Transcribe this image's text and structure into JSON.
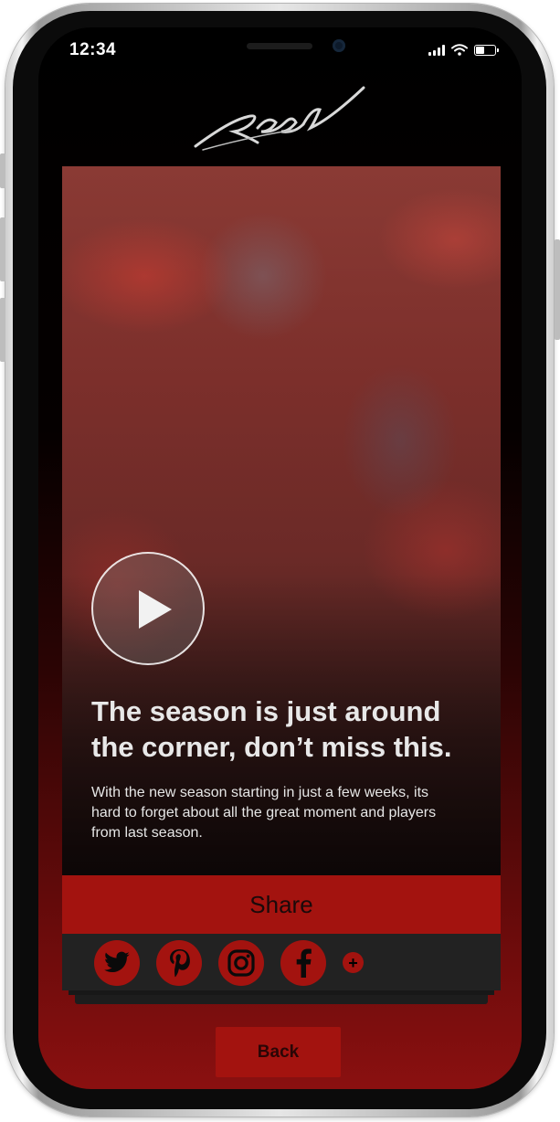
{
  "status_bar": {
    "time": "12:34",
    "battery_level": 0.45
  },
  "app": {
    "logo_icon": "reel-script-logo"
  },
  "story": {
    "headline": "The season is just around the corner, don’t miss this.",
    "body": "With the new season starting in just a few weeks, its hard to forget about all the great moment and players from last season."
  },
  "share": {
    "label": "Share",
    "networks": [
      {
        "name": "Twitter",
        "icon": "twitter-icon"
      },
      {
        "name": "Pinterest",
        "icon": "pinterest-icon"
      },
      {
        "name": "Instagram",
        "icon": "instagram-icon"
      },
      {
        "name": "Facebook",
        "icon": "facebook-icon"
      }
    ],
    "more_symbol": "+"
  },
  "back": {
    "label": "Back"
  },
  "colors": {
    "accent": "#a3130f",
    "card_dark": "#222222",
    "background": "#000000"
  }
}
